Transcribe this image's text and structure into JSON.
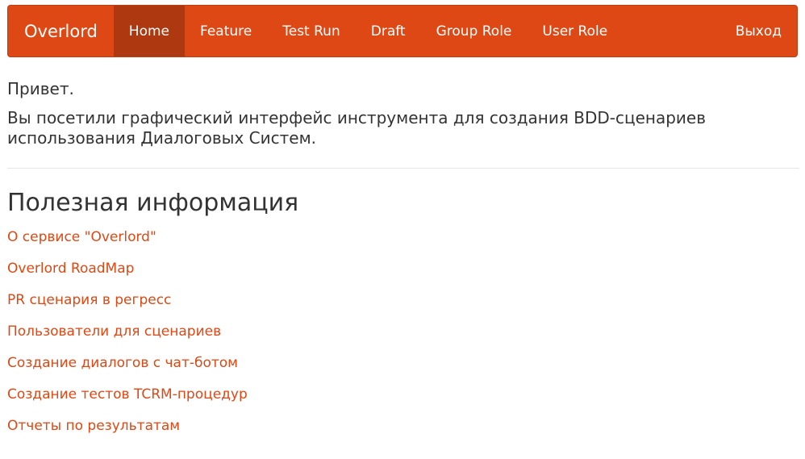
{
  "navbar": {
    "brand": "Overlord",
    "items": [
      {
        "label": "Home",
        "active": true
      },
      {
        "label": "Feature",
        "active": false
      },
      {
        "label": "Test Run",
        "active": false
      },
      {
        "label": "Draft",
        "active": false
      },
      {
        "label": "Group Role",
        "active": false
      },
      {
        "label": "User Role",
        "active": false
      }
    ],
    "logout": "Выход"
  },
  "main": {
    "greeting": "Привет.",
    "intro": "Вы посетили графический интерфейс инструмента для создания BDD-сценариев использования Диалоговых Систем.",
    "section_title": "Полезная информация",
    "links": [
      "О сервисе \"Overlord\"",
      "Overlord RoadMap",
      "PR сценария в регресс",
      "Пользователи для сценариев",
      "Создание диалогов с чат-ботом",
      "Создание тестов TCRM-процедур",
      "Отчеты по результатам"
    ]
  },
  "colors": {
    "accent": "#dd4814",
    "nav_active": "#ae3910",
    "text": "#333333"
  }
}
